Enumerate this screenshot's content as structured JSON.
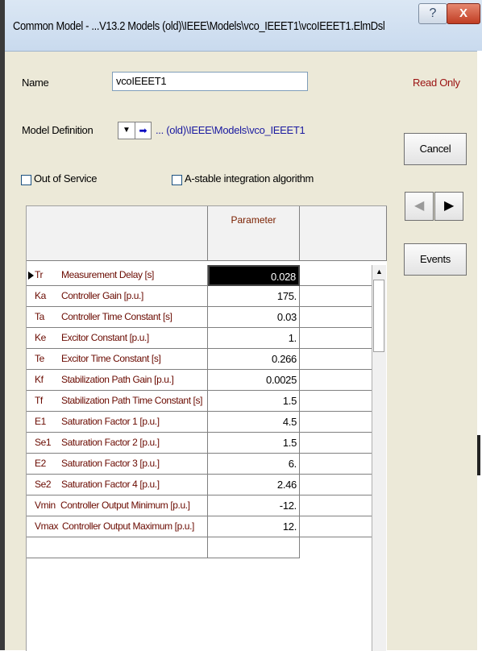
{
  "window": {
    "title": "Common Model - ...V13.2 Models (old)\\IEEE\\Models\\vco_IEEET1\\vcoIEEET1.ElmDsl",
    "help_label": "?",
    "close_label": "X"
  },
  "form": {
    "name_label": "Name",
    "name_value": "vcoIEEET1",
    "readonly_label": "Read Only",
    "model_def_label": "Model Definition",
    "model_def_dropdown_icon": "▼",
    "model_def_jump_icon": "➡",
    "model_def_path": "... (old)\\IEEE\\Models\\vco_IEEET1",
    "out_of_service_label": "Out of Service",
    "astable_label": "A-stable integration algorithm"
  },
  "buttons": {
    "cancel": "Cancel",
    "prev_icon": "◀",
    "next_icon": "▶",
    "events": "Events"
  },
  "grid": {
    "header_parameter": "Parameter",
    "scroll_up_icon": "▲",
    "rows": [
      {
        "name": "Tr",
        "desc": "Measurement Delay [s]",
        "value": "0.028"
      },
      {
        "name": "Ka",
        "desc": "Controller Gain [p.u.]",
        "value": "175."
      },
      {
        "name": "Ta",
        "desc": "Controller Time Constant [s]",
        "value": "0.03"
      },
      {
        "name": "Ke",
        "desc": "Excitor Constant [p.u.]",
        "value": "1."
      },
      {
        "name": "Te",
        "desc": "Excitor Time Constant [s]",
        "value": "0.266"
      },
      {
        "name": "Kf",
        "desc": "Stabilization Path Gain [p.u.]",
        "value": "0.0025"
      },
      {
        "name": "Tf",
        "desc": "Stabilization Path Time Constant [s]",
        "value": "1.5"
      },
      {
        "name": "E1",
        "desc": "Saturation Factor 1 [p.u.]",
        "value": "4.5"
      },
      {
        "name": "Se1",
        "desc": "Saturation Factor 2 [p.u.]",
        "value": "1.5"
      },
      {
        "name": "E2",
        "desc": "Saturation Factor 3 [p.u.]",
        "value": "6."
      },
      {
        "name": "Se2",
        "desc": "Saturation Factor 4 [p.u.]",
        "value": "2.46"
      },
      {
        "name": "Vmin",
        "desc": "Controller Output Minimum [p.u.]",
        "value": "-12."
      },
      {
        "name": "Vmax",
        "desc": "Controller Output Maximum [p.u.]",
        "value": "12."
      }
    ]
  }
}
